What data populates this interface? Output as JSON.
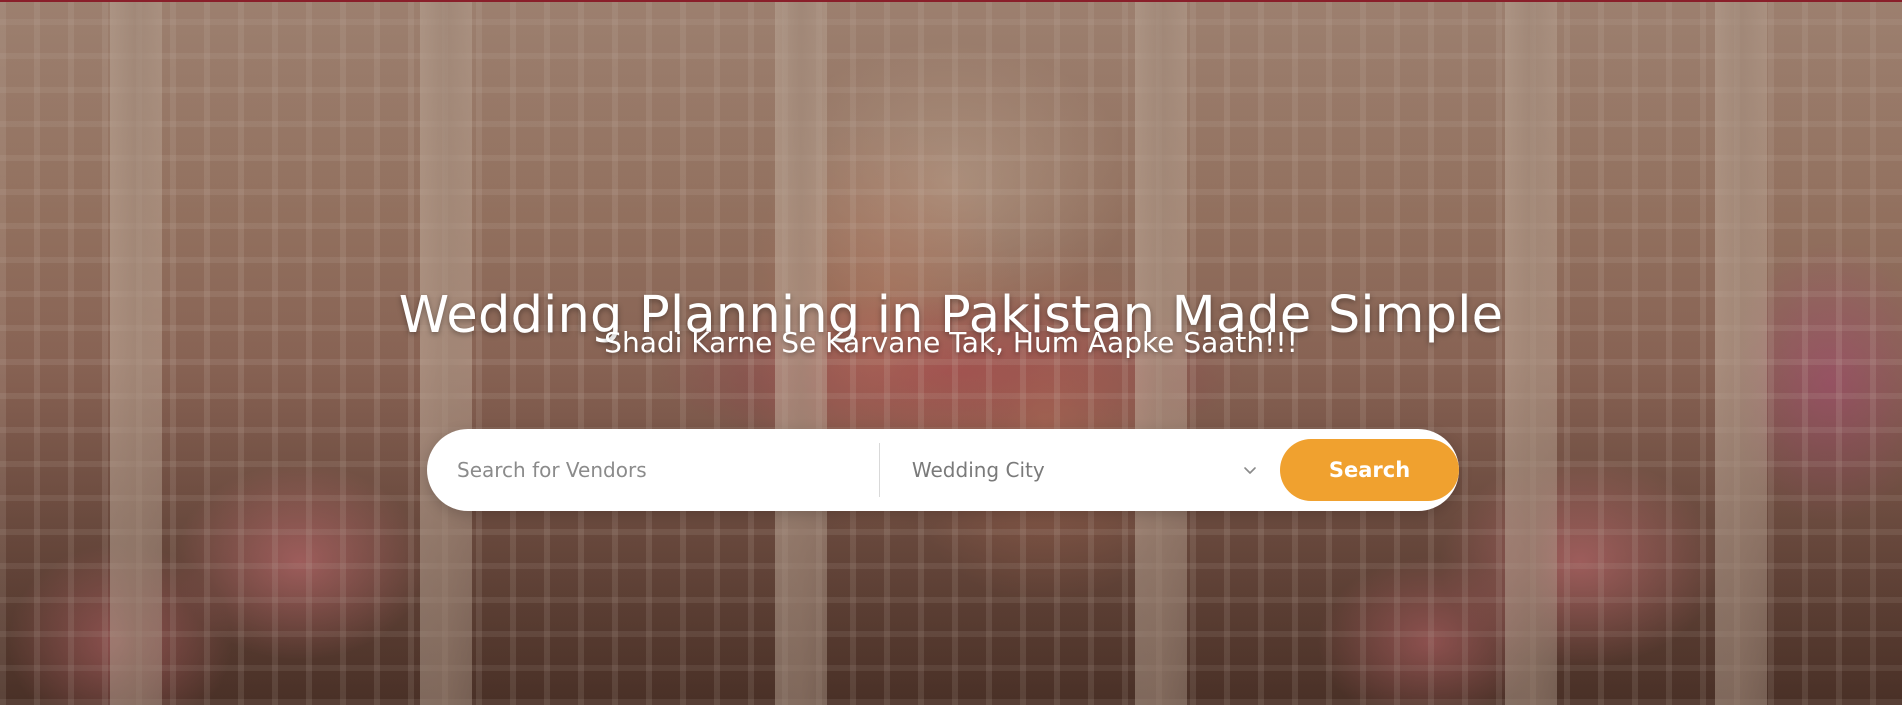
{
  "hero": {
    "background_image": "wedding-couple-photo",
    "headline": "Wedding Planning in Pakistan Made Simple",
    "subheadline": "Shadi Karne Se Karvane Tak, Hum Aapke Saath!!!"
  },
  "search": {
    "vendor_placeholder": "Search for Vendors",
    "vendor_value": "",
    "city_selected": "Wedding City",
    "city_icon": "chevron-down-icon",
    "button_label": "Search"
  },
  "colors": {
    "accent": "#f0a12f",
    "headline_text": "#ffffff",
    "search_bar_bg": "#ffffff"
  }
}
